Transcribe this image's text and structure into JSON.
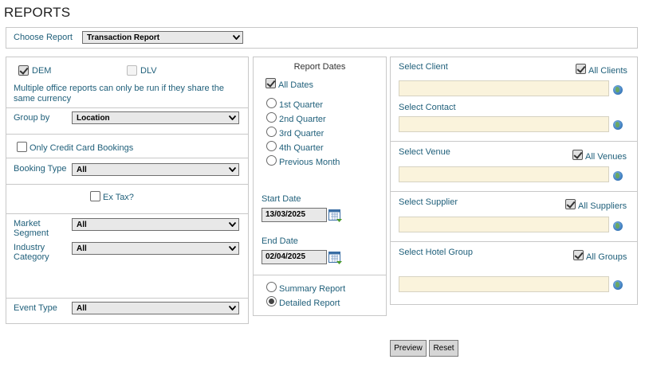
{
  "page": {
    "title": "REPORTS"
  },
  "choose_report": {
    "label": "Choose Report",
    "value": "Transaction Report"
  },
  "offices": {
    "dem_label": "DEM",
    "dem_checked": true,
    "dlv_label": "DLV",
    "dlv_checked": false,
    "note": "Multiple office reports can only be run if they share the same currency"
  },
  "group_by": {
    "label": "Group by",
    "value": "Location"
  },
  "credit_card": {
    "label": "Only Credit Card Bookings",
    "checked": false
  },
  "booking_type": {
    "label": "Booking Type",
    "value": "All"
  },
  "ex_tax": {
    "label": "Ex Tax?",
    "checked": false
  },
  "market_segment": {
    "label": "Market Segment",
    "value": "All"
  },
  "industry_category": {
    "label": "Industry Category",
    "value": "All"
  },
  "event_type": {
    "label": "Event Type",
    "value": "All"
  },
  "report_dates": {
    "heading": "Report Dates",
    "all_dates_label": "All Dates",
    "all_dates_checked": true,
    "options": [
      "1st Quarter",
      "2nd Quarter",
      "3rd Quarter",
      "4th Quarter",
      "Previous Month"
    ],
    "start_label": "Start Date",
    "start_value": "13/03/2025",
    "end_label": "End Date",
    "end_value": "02/04/2025"
  },
  "report_type": {
    "summary_label": "Summary Report",
    "detailed_label": "Detailed Report",
    "selected": "Detailed Report"
  },
  "client": {
    "label": "Select Client",
    "all_label": "All Clients",
    "all_checked": true,
    "contact_label": "Select Contact"
  },
  "venue": {
    "label": "Select Venue",
    "all_label": "All Venues",
    "all_checked": true
  },
  "supplier": {
    "label": "Select Supplier",
    "all_label": "All Suppliers",
    "all_checked": true
  },
  "hotel_group": {
    "label": "Select Hotel Group",
    "all_label": "All Groups",
    "all_checked": true
  },
  "buttons": {
    "preview": "Preview",
    "reset": "Reset"
  },
  "icons": [
    "chevron-down-icon",
    "calendar-icon",
    "globe-icon"
  ]
}
